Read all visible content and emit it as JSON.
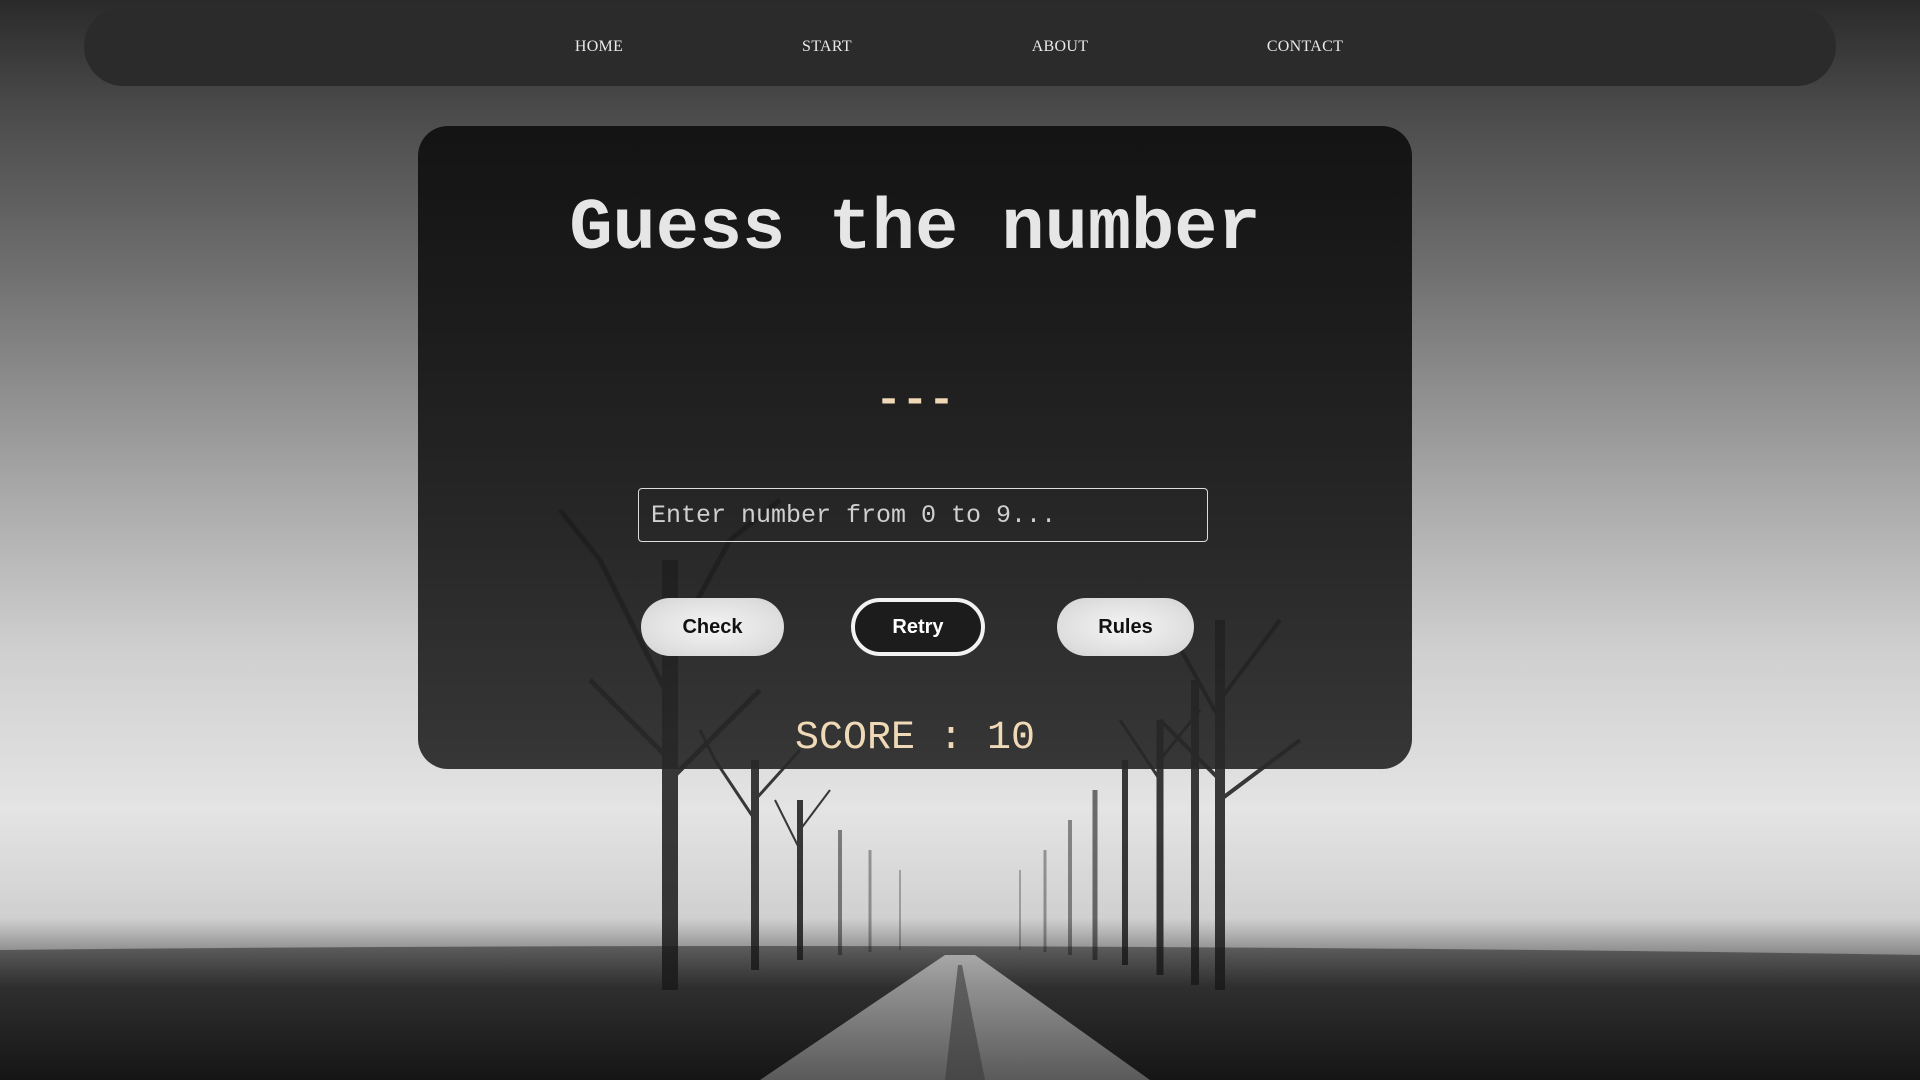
{
  "nav": {
    "items": [
      {
        "label": "HOME"
      },
      {
        "label": "START"
      },
      {
        "label": "ABOUT"
      },
      {
        "label": "CONTACT"
      }
    ]
  },
  "game": {
    "title": "Guess the number",
    "secret_display": "---",
    "input": {
      "value": "",
      "placeholder": "Enter number from 0 to 9..."
    },
    "buttons": {
      "check_label": "Check",
      "retry_label": "Retry",
      "rules_label": "Rules"
    },
    "score_text": "SCORE : 10"
  },
  "colors": {
    "accent_text": "#f1d9b8",
    "panel_bg": "#1c1c1c",
    "navbar_bg": "#2b2b2b"
  }
}
